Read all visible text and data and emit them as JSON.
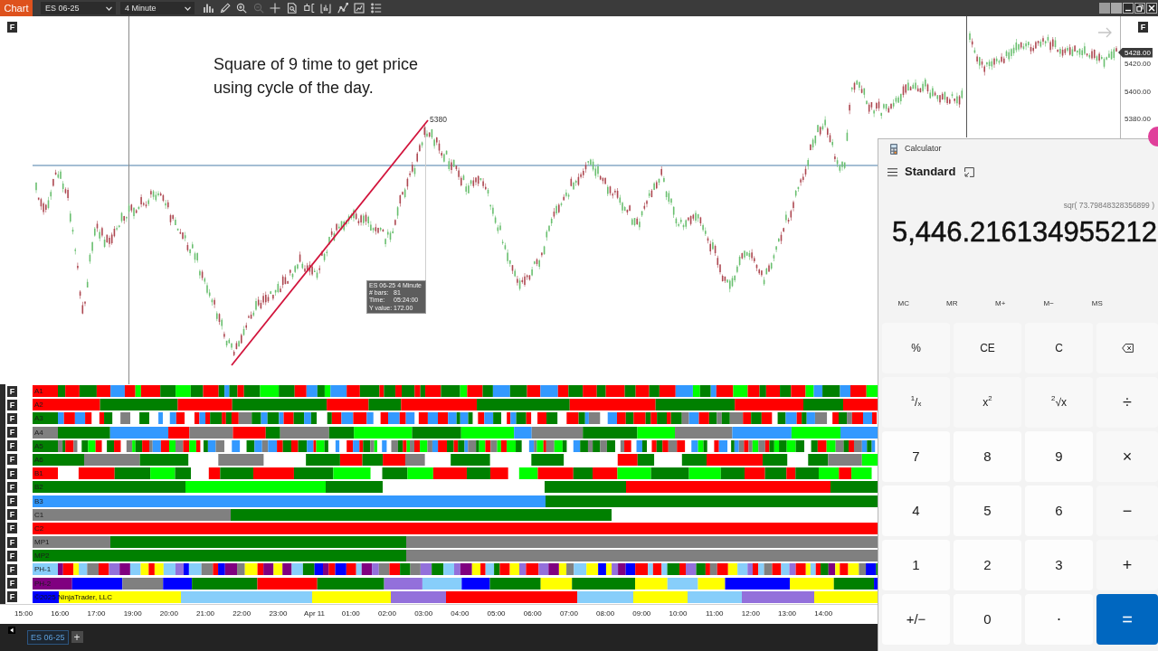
{
  "toolbar": {
    "app_button": "Chart",
    "instrument": "ES 06-25",
    "interval": "4 Minute",
    "tools": [
      {
        "disabled": false
      },
      {
        "disabled": false
      },
      {
        "disabled": false
      },
      {
        "disabled": true
      },
      {
        "disabled": false
      },
      {
        "disabled": false
      },
      {
        "disabled": false
      },
      {
        "disabled": false
      },
      {
        "disabled": false
      },
      {
        "disabled": false
      },
      {
        "disabled": false
      }
    ]
  },
  "price_panel": {
    "left_button": "F",
    "right_button": "F",
    "annotation": [
      "Square of 9 time to get price",
      "using cycle of the day."
    ],
    "line_label": "5380",
    "tooltip": {
      "title": "ES 06-25 4 Minute",
      "rows": [
        {
          "label": "# bars:",
          "value": "81"
        },
        {
          "label": "Time:",
          "value": "05:24:00"
        },
        {
          "label": "Y value:",
          "value": "172.00"
        }
      ]
    },
    "price_axis": [
      {
        "label": "5428.00",
        "kind": "last"
      },
      {
        "label": "5420.00",
        "kind": "tick"
      },
      {
        "label": "5400.00",
        "kind": "tick"
      },
      {
        "label": "5380.00",
        "kind": "tick"
      }
    ]
  },
  "indicators": [
    {
      "label": "A1",
      "button": "F"
    },
    {
      "label": "A2",
      "button": "F"
    },
    {
      "label": "A3",
      "button": "F"
    },
    {
      "label": "A4",
      "button": "F"
    },
    {
      "label": "A5",
      "button": "F"
    },
    {
      "label": "A6",
      "button": "F"
    },
    {
      "label": "B1",
      "button": "F"
    },
    {
      "label": "B2",
      "button": "F"
    },
    {
      "label": "B3",
      "button": "F"
    },
    {
      "label": "C1",
      "button": "F"
    },
    {
      "label": "C2",
      "button": "F"
    },
    {
      "label": "MP1",
      "button": "F"
    },
    {
      "label": "MP2",
      "button": "F"
    },
    {
      "label": "PH-1",
      "button": "F"
    },
    {
      "label": "PH-2",
      "button": "F"
    },
    {
      "button": "F"
    }
  ],
  "copyright": "©2025 NinjaTrader, LLC",
  "time_axis": [
    "15:00",
    "16:00",
    "17:00",
    "19:00",
    "20:00",
    "21:00",
    "22:00",
    "23:00",
    "Apr 11",
    "01:00",
    "02:00",
    "03:00",
    "04:00",
    "05:00",
    "06:00",
    "07:00",
    "08:00",
    "09:00",
    "10:00",
    "11:00",
    "12:00",
    "13:00",
    "14:00"
  ],
  "tabs": [
    {
      "label": "ES 06-25",
      "selected": true
    }
  ],
  "add_tab": "+",
  "calculator": {
    "title": "Calculator",
    "mode": "Standard",
    "expression": "sqr( 73.79848328356899 )",
    "display": "5,446.216134955212",
    "memory": [
      "MC",
      "MR",
      "M+",
      "M−",
      "MS"
    ],
    "keys": [
      {
        "label": "%",
        "kind": "function"
      },
      {
        "label": "CE",
        "kind": "function"
      },
      {
        "label": "C",
        "kind": "function"
      },
      {
        "kind": "backspace"
      },
      {
        "label": "$^{1}$/$_{x}$",
        "kind": "function"
      },
      {
        "label": "x$^{2}$",
        "kind": "function"
      },
      {
        "label": "$^{2}$√x",
        "kind": "function"
      },
      {
        "label": "÷",
        "kind": "operator"
      },
      {
        "label": "7",
        "kind": "digit"
      },
      {
        "label": "8",
        "kind": "digit"
      },
      {
        "label": "9",
        "kind": "digit"
      },
      {
        "label": "×",
        "kind": "operator"
      },
      {
        "label": "4",
        "kind": "digit"
      },
      {
        "label": "5",
        "kind": "digit"
      },
      {
        "label": "6",
        "kind": "digit"
      },
      {
        "label": "−",
        "kind": "operator"
      },
      {
        "label": "1",
        "kind": "digit"
      },
      {
        "label": "2",
        "kind": "digit"
      },
      {
        "label": "3",
        "kind": "digit"
      },
      {
        "label": "+",
        "kind": "operator"
      },
      {
        "label": "+/−",
        "kind": "digit"
      },
      {
        "label": "0",
        "kind": "digit"
      },
      {
        "label": ".",
        "kind": "decimal"
      },
      {
        "label": "=",
        "kind": "equals"
      }
    ]
  }
}
